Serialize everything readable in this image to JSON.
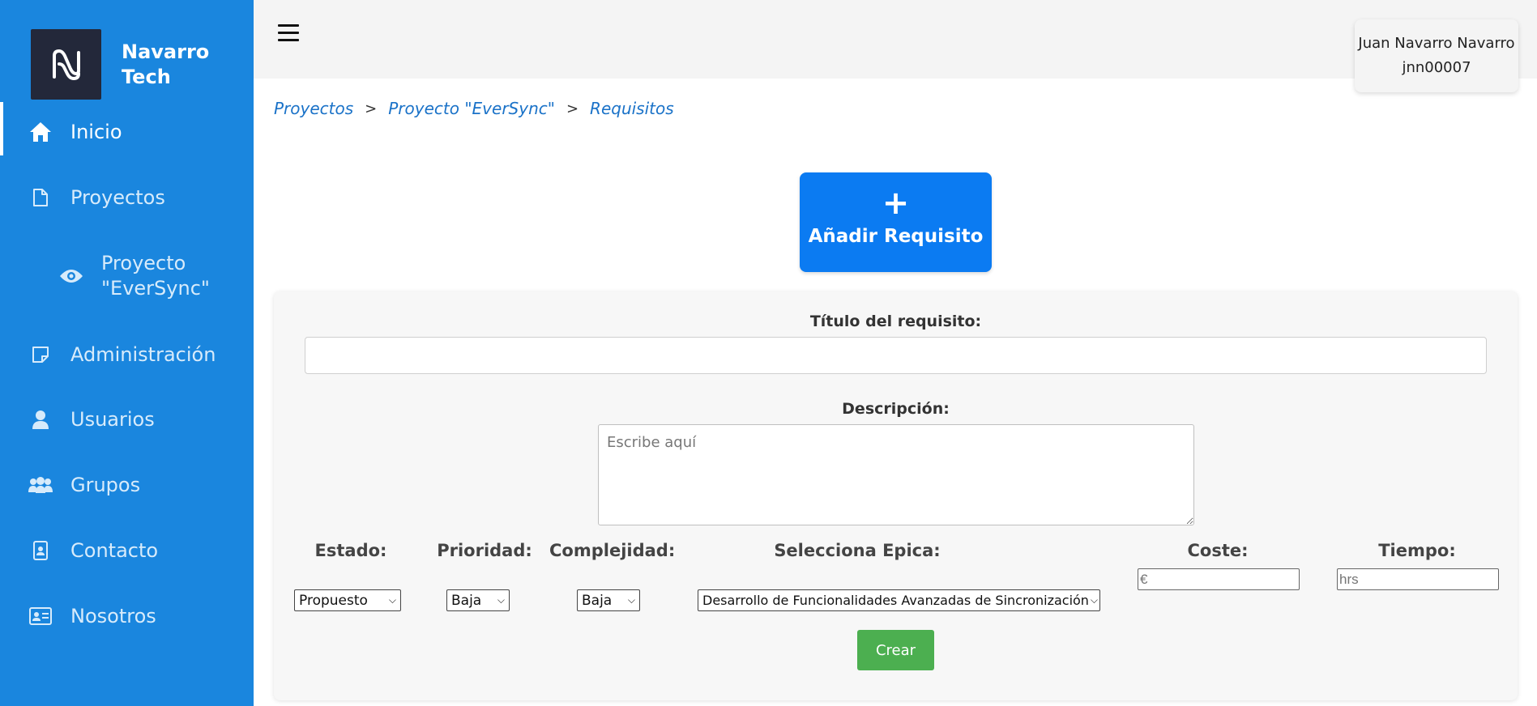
{
  "brand": {
    "name": "Navarro Tech"
  },
  "sidebar": {
    "items": [
      {
        "label": "Inicio",
        "icon": "home-icon"
      },
      {
        "label": "Proyectos",
        "icon": "document-icon"
      },
      {
        "label": "Proyecto \"EverSync\"",
        "icon": "eye-icon"
      },
      {
        "label": "Administración",
        "icon": "note-icon"
      },
      {
        "label": "Usuarios",
        "icon": "user-icon"
      },
      {
        "label": "Grupos",
        "icon": "group-icon"
      },
      {
        "label": "Contacto",
        "icon": "contact-badge-icon"
      },
      {
        "label": "Nosotros",
        "icon": "id-card-icon"
      }
    ]
  },
  "user": {
    "name": "Juan Navarro Navarro",
    "username": "jnn00007"
  },
  "breadcrumb": {
    "items": [
      "Proyectos",
      "Proyecto \"EverSync\"",
      "Requisitos"
    ],
    "separator": ">"
  },
  "add_button": {
    "icon": "+",
    "label": "Añadir Requisito"
  },
  "form": {
    "title_label": "Título del requisito:",
    "title_value": "",
    "description_label": "Descripción:",
    "description_placeholder": "Escribe aquí",
    "estado": {
      "label": "Estado:",
      "value": "Propuesto"
    },
    "prioridad": {
      "label": "Prioridad:",
      "value": "Baja"
    },
    "complejidad": {
      "label": "Complejidad:",
      "value": "Baja"
    },
    "epica": {
      "label": "Selecciona Epica:",
      "value": "Desarrollo de Funcionalidades Avanzadas de Sincronización:"
    },
    "coste": {
      "label": "Coste:",
      "placeholder": "€"
    },
    "tiempo": {
      "label": "Tiempo:",
      "placeholder": "hrs"
    },
    "submit_label": "Crear"
  },
  "colors": {
    "sidebar": "#1a86de",
    "primary_button": "#0b7bf2",
    "submit_button": "#4caf50",
    "link": "#1a72c8"
  }
}
